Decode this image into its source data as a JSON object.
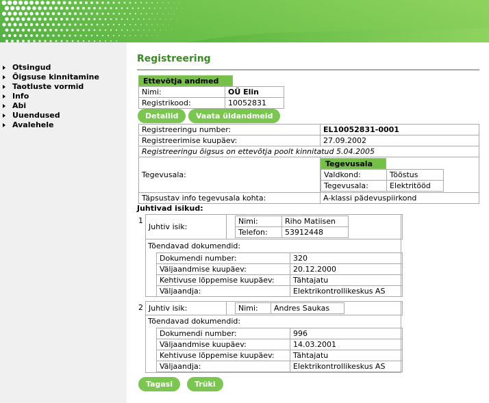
{
  "sidebar": {
    "items": [
      {
        "label": "Otsingud"
      },
      {
        "label": "Õigsuse kinnitamine"
      },
      {
        "label": "Taotluste vormid"
      },
      {
        "label": "Info"
      },
      {
        "label": "Abi"
      },
      {
        "label": "Uuendused"
      },
      {
        "label": "Avalehele"
      }
    ]
  },
  "page": {
    "title": "Registreering"
  },
  "company": {
    "header": "Ettevõtja andmed",
    "name_label": "Nimi:",
    "name_value": "OÜ Elin",
    "code_label": "Registrikood:",
    "code_value": "10052831"
  },
  "buttons": {
    "details": "Detailid",
    "general": "Vaata üldandmeid",
    "back": "Tagasi",
    "print": "Trüki"
  },
  "registration": {
    "number_label": "Registreeringu number:",
    "number_value": "EL10052831-0001",
    "date_label": "Registreerimise kuupäev:",
    "date_value": "27.09.2002",
    "verified_note": "Registreeringu õigsus on ettevõtja poolt kinnitatud 5.04.2005",
    "activity_label": "Tegevusala:",
    "activity": {
      "header": "Tegevusala",
      "field_label": "Valdkond:",
      "field_value": "Tööstus",
      "area_label": "Tegevusala:",
      "area_value": "Elektritööd"
    },
    "info_label": "Täpsustav info tegevusala kohta:",
    "info_value": "A-klassi pädevuspiirkond"
  },
  "managers": {
    "heading": "Juhtivad isikud:",
    "person_label": "Juhtiv isik:",
    "name_label": "Nimi:",
    "phone_label": "Telefon:",
    "docs_heading": "Tõendavad dokumendid:",
    "doc_number_label": "Dokumendi number:",
    "issue_date_label": "Väljaandmise kuupäev:",
    "expiry_label": "Kehtivuse lõppemise kuupäev:",
    "issuer_label": "Väljaandja:",
    "list": [
      {
        "index": "1",
        "name": "Riho Matiisen",
        "phone": "53912448",
        "doc_number": "320",
        "issue_date": "20.12.2000",
        "expiry": "Tähtajatu",
        "issuer": "Elektrikontrollikeskus AS"
      },
      {
        "index": "2",
        "name": "Andres Saukas",
        "doc_number": "996",
        "issue_date": "14.03.2001",
        "expiry": "Tähtajatu",
        "issuer": "Elektrikontrollikeskus AS"
      }
    ]
  },
  "colors": {
    "accent": "#7ac651",
    "title": "#3b8a25",
    "sidebar_bg": "#f0f0f0",
    "border": "#aaaaaa"
  }
}
